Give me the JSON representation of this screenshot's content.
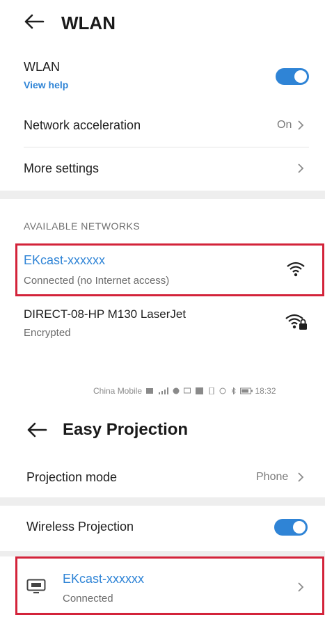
{
  "wlan": {
    "header": {
      "title": "WLAN"
    },
    "toggle_row": {
      "label": "WLAN",
      "sublabel": "View help",
      "enabled": true
    },
    "rows": [
      {
        "label": "Network acceleration",
        "value": "On"
      },
      {
        "label": "More settings",
        "value": ""
      }
    ],
    "section_header": "AVAILABLE NETWORKS",
    "networks": [
      {
        "name": "EKcast-xxxxxx",
        "status": "Connected (no Internet access)",
        "icon": "wifi-icon"
      },
      {
        "name": "DIRECT-08-HP M130 LaserJet",
        "status": "Encrypted",
        "icon": "wifi-locked-icon"
      }
    ]
  },
  "status_bar": {
    "carrier": "China Mobile",
    "time": "18:32"
  },
  "projection": {
    "header": {
      "title": "Easy Projection"
    },
    "mode_row": {
      "label": "Projection mode",
      "value": "Phone"
    },
    "wireless_row": {
      "label": "Wireless Projection",
      "enabled": true
    },
    "device": {
      "name": "EKcast-xxxxxx",
      "status": "Connected",
      "icon": "monitor-icon"
    }
  },
  "colors": {
    "accent": "#2f84d6",
    "highlight": "#d3233a",
    "separator": "#eeeeee"
  }
}
